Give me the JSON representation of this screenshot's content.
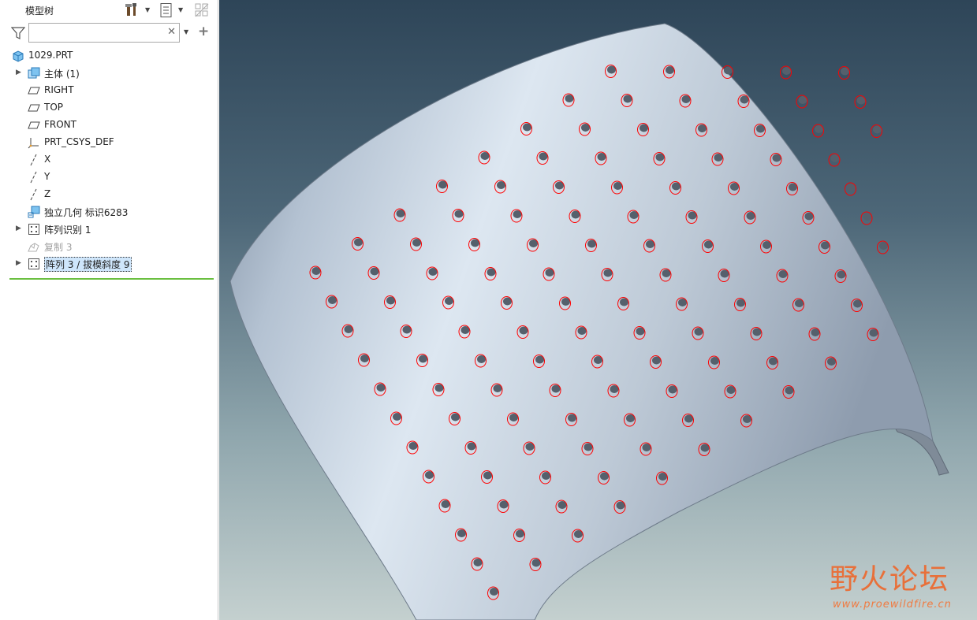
{
  "model_tree": {
    "title": "模型树",
    "search": {
      "value": "",
      "placeholder": ""
    },
    "items": [
      {
        "label": "1029.PRT",
        "icon": "part-icon",
        "expandable": false
      },
      {
        "label": "主体 (1)",
        "icon": "body-icon",
        "expandable": true
      },
      {
        "label": "RIGHT",
        "icon": "datum-plane-icon",
        "expandable": false
      },
      {
        "label": "TOP",
        "icon": "datum-plane-icon",
        "expandable": false
      },
      {
        "label": "FRONT",
        "icon": "datum-plane-icon",
        "expandable": false
      },
      {
        "label": "PRT_CSYS_DEF",
        "icon": "csys-icon",
        "expandable": false
      },
      {
        "label": "X",
        "icon": "datum-axis-icon",
        "expandable": false
      },
      {
        "label": "Y",
        "icon": "datum-axis-icon",
        "expandable": false
      },
      {
        "label": "Z",
        "icon": "datum-axis-icon",
        "expandable": false
      },
      {
        "label": "独立几何 标识6283",
        "icon": "independent-geometry-icon",
        "expandable": false
      },
      {
        "label": "阵列识别 1",
        "icon": "pattern-icon",
        "expandable": true
      },
      {
        "label": "复制 3",
        "icon": "copy-icon",
        "expandable": false,
        "suppressed": true
      },
      {
        "label": "阵列 3 / 拔模斜度 9",
        "icon": "pattern-icon",
        "expandable": true,
        "selected": true
      }
    ]
  },
  "watermark": {
    "text": "野火论坛",
    "url": "www.proewildfire.cn"
  },
  "colors": {
    "hole_edge": "#ff0000",
    "part_surface": "#c6d2dd",
    "insert_line": "#6abf40",
    "selection": "#cfe6fb"
  }
}
